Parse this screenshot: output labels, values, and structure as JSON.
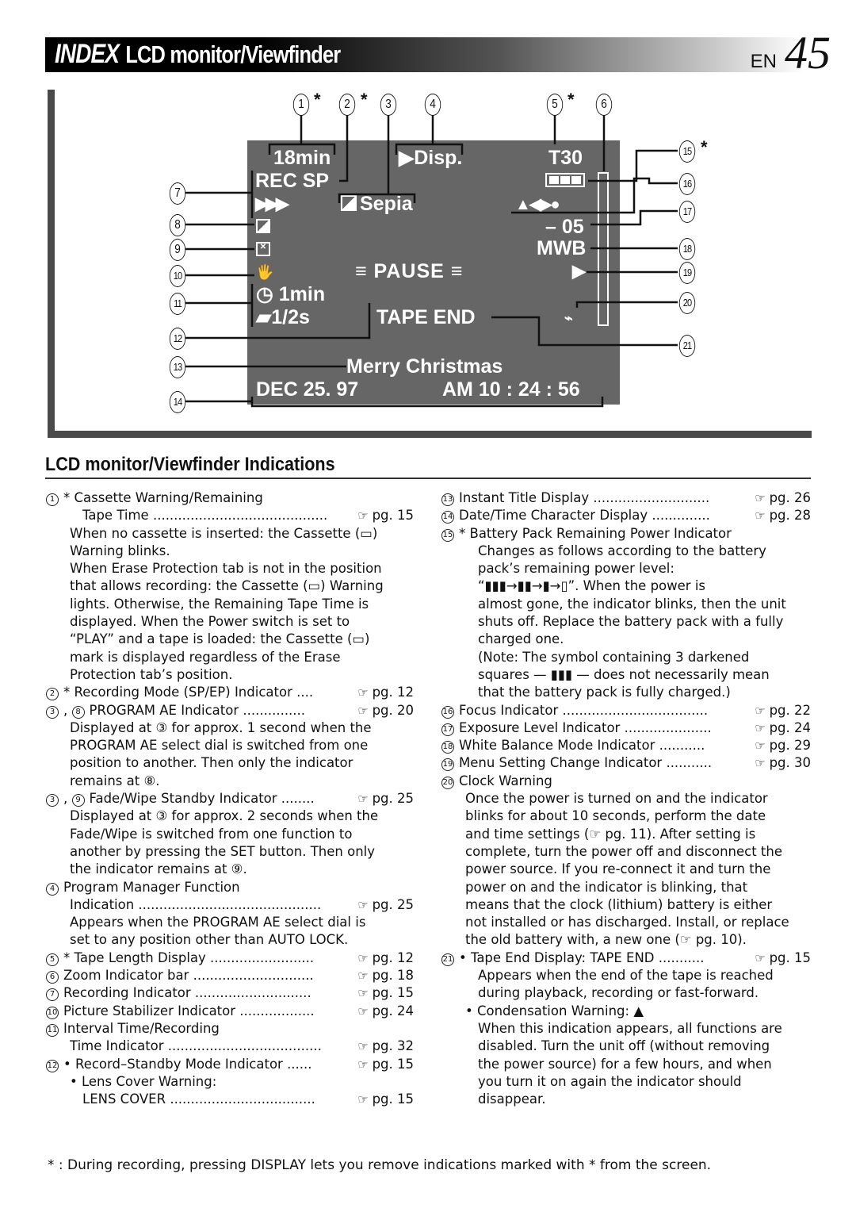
{
  "header": {
    "index_label": "INDEX",
    "title": "LCD monitor/Viewfinder",
    "lang": "EN",
    "page_number": "45"
  },
  "diagram": {
    "lcd": {
      "remaining_time": "18min",
      "rec_mode": "REC SP",
      "program_manager": "Disp.",
      "tape_length": "T30",
      "recording_arrows": "▶▶▶",
      "program_ae": "Sepia",
      "exposure": "– 05",
      "white_balance": "MWB",
      "status": "PAUSE",
      "interval_time": "1min",
      "record_time": "1/2s",
      "tape_end": "TAPE END",
      "title": "Merry  Christmas",
      "date": "DEC  25. 97",
      "time": "AM 10 : 24 : 56",
      "battery_level": "3/3"
    },
    "callouts": [
      "1",
      "2",
      "3",
      "4",
      "5",
      "6",
      "7",
      "8",
      "9",
      "10",
      "11",
      "12",
      "13",
      "14",
      "15",
      "16",
      "17",
      "18",
      "19",
      "20",
      "21"
    ],
    "star": "*"
  },
  "section": {
    "heading": "LCD monitor/Viewfinder Indications"
  },
  "left_column": [
    {
      "num": "1",
      "text": "* Cassette Warning/Remaining"
    },
    {
      "text": "Tape Time ..........................................",
      "ref": "pg. 15",
      "indent": 2
    },
    {
      "text": "When no cassette is inserted: the Cassette (▭)",
      "indent": 1
    },
    {
      "text": "Warning blinks.",
      "indent": 1
    },
    {
      "text": "When Erase Protection tab is not in the position",
      "indent": 1
    },
    {
      "text": "that allows recording: the Cassette (▭) Warning",
      "indent": 1
    },
    {
      "text": "lights. Otherwise, the Remaining Tape Time is",
      "indent": 1
    },
    {
      "text": "displayed. When the Power switch is set to",
      "indent": 1
    },
    {
      "text": "“PLAY” and a tape is loaded: the Cassette (▭)",
      "indent": 1
    },
    {
      "text": "mark is displayed regardless of the Erase",
      "indent": 1
    },
    {
      "text": "Protection tab’s position.",
      "indent": 1
    },
    {
      "num": "2",
      "text": "* Recording Mode (SP/EP) Indicator ....",
      "ref": "pg. 12"
    },
    {
      "num": "3, 8",
      "text": "PROGRAM AE Indicator ...............",
      "ref": "pg. 20"
    },
    {
      "text": "Displayed at ③ for approx. 1 second when the",
      "indent": 1
    },
    {
      "text": "PROGRAM AE select dial is switched from one",
      "indent": 1
    },
    {
      "text": "position to another. Then only the indicator",
      "indent": 1
    },
    {
      "text": "remains at ⑧.",
      "indent": 1
    },
    {
      "num": "3, 9",
      "text": "Fade/Wipe Standby Indicator ........",
      "ref": "pg. 25"
    },
    {
      "text": "Displayed at ③ for approx. 2 seconds when the",
      "indent": 1
    },
    {
      "text": "Fade/Wipe is switched from one function to",
      "indent": 1
    },
    {
      "text": "another by pressing the SET button. Then only",
      "indent": 1
    },
    {
      "text": "the indicator remains at ⑨.",
      "indent": 1
    },
    {
      "num": "4",
      "text": "Program Manager Function"
    },
    {
      "text": "Indication ............................................",
      "ref": "pg. 25",
      "indent": 1
    },
    {
      "text": "Appears when the PROGRAM AE select dial is",
      "indent": 1
    },
    {
      "text": "set to any position other than AUTO LOCK.",
      "indent": 1
    },
    {
      "num": "5",
      "text": "* Tape Length Display .........................",
      "ref": "pg. 12"
    },
    {
      "num": "6",
      "text": "Zoom Indicator bar .............................",
      "ref": "pg. 18"
    },
    {
      "num": "7",
      "text": "Recording Indicator ............................",
      "ref": "pg. 15"
    },
    {
      "num": "10",
      "text": "Picture Stabilizer Indicator ..................",
      "ref": "pg. 24"
    },
    {
      "num": "11",
      "text": "Interval Time/Recording"
    },
    {
      "text": "Time Indicator .....................................",
      "ref": "pg. 32",
      "indent": 1
    },
    {
      "num": "12",
      "text": "• Record–Standby Mode Indicator ......",
      "ref": "pg. 15"
    },
    {
      "text": "• Lens Cover Warning:",
      "indent": 1
    },
    {
      "text": "LENS COVER ...................................",
      "ref": "pg. 15",
      "indent": 2
    }
  ],
  "right_column": [
    {
      "num": "13",
      "text": "Instant Title Display ............................",
      "ref": "pg. 26"
    },
    {
      "num": "14",
      "text": "Date/Time Character Display ..............",
      "ref": "pg. 28"
    },
    {
      "num": "15",
      "text": "* Battery Pack Remaining Power Indicator"
    },
    {
      "text": "Changes as follows according to the battery",
      "indent": 2
    },
    {
      "text": "pack’s remaining power level:",
      "indent": 2
    },
    {
      "text": "“▮▮▮→▮▮→▮→▯”. When the power is",
      "indent": 2,
      "battery": true
    },
    {
      "text": "almost gone, the indicator blinks, then the unit",
      "indent": 2
    },
    {
      "text": "shuts off. Replace the battery pack with a fully",
      "indent": 2
    },
    {
      "text": "charged one.",
      "indent": 2
    },
    {
      "text": "(Note:  The symbol containing 3 darkened",
      "indent": 2,
      "bold_prefix": "Note:"
    },
    {
      "text": "squares — ▮▮▮ — does not necessarily mean",
      "indent": 2
    },
    {
      "text": "that the battery pack is fully charged.)",
      "indent": 2
    },
    {
      "num": "16",
      "text": "Focus Indicator ...................................",
      "ref": "pg. 22"
    },
    {
      "num": "17",
      "text": "Exposure Level Indicator .....................",
      "ref": "pg. 24"
    },
    {
      "num": "18",
      "text": "White Balance Mode Indicator ...........",
      "ref": "pg. 29"
    },
    {
      "num": "19",
      "text": "Menu Setting Change Indicator ...........",
      "ref": "pg. 30"
    },
    {
      "num": "20",
      "text": "Clock Warning"
    },
    {
      "text": "Once the power is turned on and the indicator",
      "indent": 1
    },
    {
      "text": "blinks for about 10 seconds, perform the date",
      "indent": 1
    },
    {
      "text": "and time settings (☞ pg. 11). After setting is",
      "indent": 1
    },
    {
      "text": "complete, turn the power off and disconnect the",
      "indent": 1
    },
    {
      "text": "power source. If you re-connect it and turn the",
      "indent": 1
    },
    {
      "text": "power on and the indicator is blinking, that",
      "indent": 1
    },
    {
      "text": "means that the clock (lithium) battery is either",
      "indent": 1
    },
    {
      "text": "not installed or has discharged. Install, or replace",
      "indent": 1
    },
    {
      "text": "the old battery with, a new one (☞ pg. 10).",
      "indent": 1
    },
    {
      "num": "21",
      "text": "• Tape End Display: TAPE END ...........",
      "ref": "pg. 15"
    },
    {
      "text": "Appears when the end of the tape is reached",
      "indent": 2
    },
    {
      "text": "during playback, recording or fast-forward.",
      "indent": 2
    },
    {
      "text": "• Condensation Warning: ▲",
      "indent": 1
    },
    {
      "text": "When this indication appears, all functions are",
      "indent": 2
    },
    {
      "text": "disabled. Turn the unit off (without removing",
      "indent": 2
    },
    {
      "text": "the power source) for a few hours, and when",
      "indent": 2
    },
    {
      "text": "you turn it on again the indicator should",
      "indent": 2
    },
    {
      "text": "disappear.",
      "indent": 2
    }
  ],
  "ref_icon": "☞",
  "footer": "* : During recording, pressing DISPLAY lets you remove indications marked with * from the screen."
}
